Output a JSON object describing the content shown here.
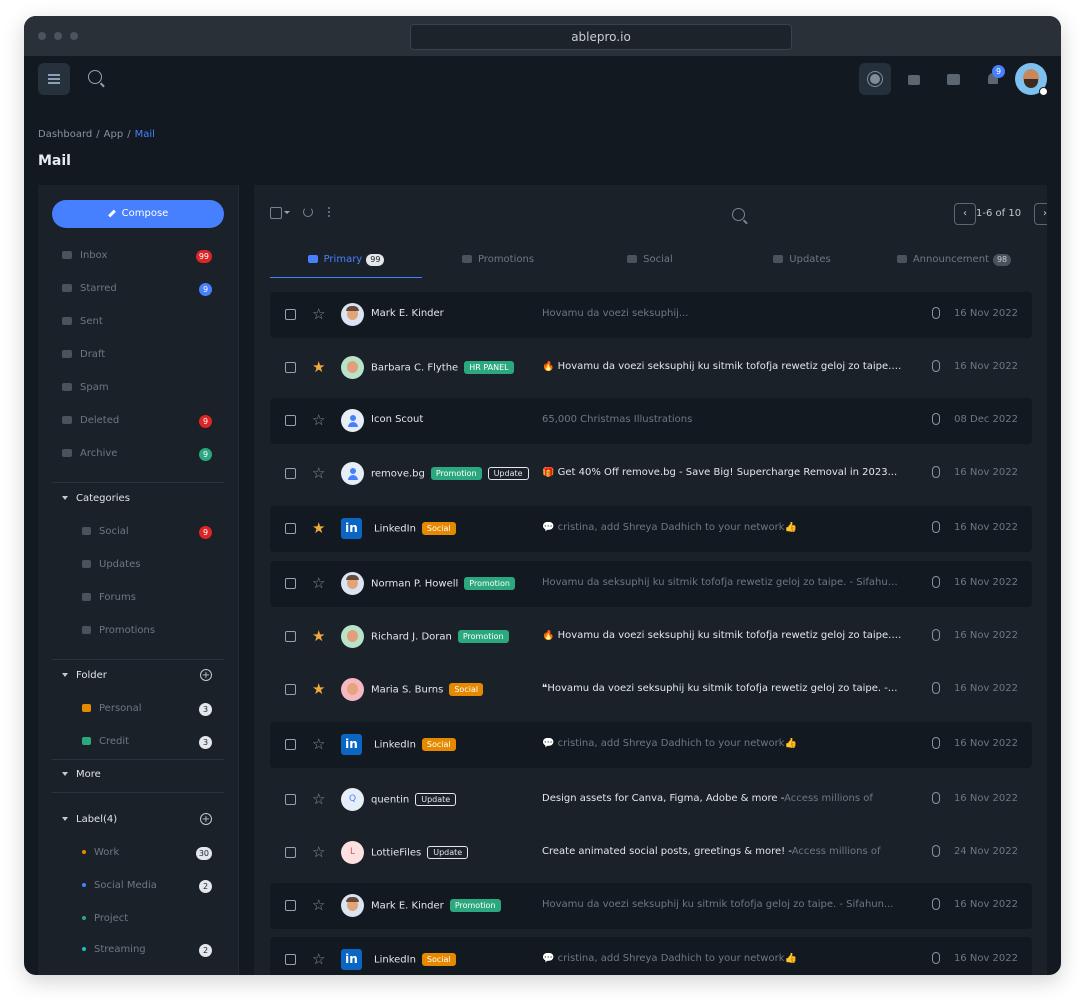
{
  "browser": {
    "url": "ablepro.io"
  },
  "topbar": {
    "notification_count": "9"
  },
  "breadcrumb": {
    "items": [
      "Dashboard",
      "App",
      "Mail"
    ]
  },
  "page": {
    "title": "Mail"
  },
  "sidebar": {
    "compose_label": "Compose",
    "mailboxes": [
      {
        "label": "Inbox",
        "count": "99",
        "badge_color": "#dc2626",
        "icon": "inbox-icon"
      },
      {
        "label": "Starred",
        "count": "9",
        "badge_color": "#4680ff",
        "icon": "star-icon"
      },
      {
        "label": "Sent",
        "count": "",
        "icon": "send-icon"
      },
      {
        "label": "Draft",
        "count": "",
        "icon": "draft-icon"
      },
      {
        "label": "Spam",
        "count": "",
        "icon": "spam-icon"
      },
      {
        "label": "Deleted",
        "count": "9",
        "badge_color": "#dc2626",
        "icon": "trash-icon"
      },
      {
        "label": "Archive",
        "count": "9",
        "badge_color": "#2ca87f",
        "icon": "archive-icon"
      }
    ],
    "categories": {
      "title": "Categories",
      "items": [
        {
          "label": "Social",
          "count": "9",
          "icon": "user-icon"
        },
        {
          "label": "Updates",
          "count": "",
          "icon": "info-icon"
        },
        {
          "label": "Forums",
          "count": "",
          "icon": "forum-icon"
        },
        {
          "label": "Promotions",
          "count": "",
          "icon": "tag-icon"
        }
      ]
    },
    "folder": {
      "title": "Folder",
      "items": [
        {
          "label": "Personal",
          "count": "3",
          "color": "#e58a00"
        },
        {
          "label": "Credit",
          "count": "3",
          "color": "#2ca87f"
        }
      ]
    },
    "more": {
      "title": "More"
    },
    "labels": {
      "title": "Label(4)",
      "items": [
        {
          "label": "Work",
          "count": "30",
          "color": "#e58a00"
        },
        {
          "label": "Social Media",
          "count": "2",
          "color": "#4680ff"
        },
        {
          "label": "Project",
          "count": "",
          "color": "#2ca87f"
        },
        {
          "label": "Streaming",
          "count": "2",
          "color": "#13c2c2"
        }
      ]
    }
  },
  "toolbar": {
    "pager_text": "1-6 of 10",
    "prev_label": "‹",
    "next_label": "›"
  },
  "tabs": [
    {
      "label": "Primary",
      "count": "99",
      "active": true
    },
    {
      "label": "Promotions",
      "count": ""
    },
    {
      "label": "Social",
      "count": ""
    },
    {
      "label": "Updates",
      "count": ""
    },
    {
      "label": "Announcement",
      "count": "98"
    }
  ],
  "emails": [
    {
      "name": "Mark E. Kinder",
      "tags": [],
      "subject": "Hovamu da voezi seksuphij...",
      "subject_bold": false,
      "date": "16 Nov 2022",
      "starred": false
    },
    {
      "name": "Barbara C. Flythe",
      "tags": [
        {
          "text": "HR PANEL",
          "style": "green"
        }
      ],
      "subject": "🔥 Hovamu da voezi seksuphij ku sitmik tofofja rewetiz geloj zo taipe. -...",
      "subject_bold": true,
      "date": "16 Nov 2022",
      "starred": true
    },
    {
      "name": "Icon Scout",
      "tags": [],
      "subject": "65,000 Christmas Illustrations",
      "subject_bold": false,
      "date": "08 Dec 2022",
      "starred": false
    },
    {
      "name": "remove.bg",
      "tags": [
        {
          "text": "Promotion",
          "style": "green"
        },
        {
          "text": "Update",
          "style": "outline"
        }
      ],
      "subject": "🎁 Get 40% Off remove.bg - Save Big! Supercharge Removal in 2023...",
      "subject_bold": true,
      "date": "16 Nov 2022",
      "starred": false
    },
    {
      "name": "LinkedIn",
      "tags": [
        {
          "text": "Social",
          "style": "orange"
        }
      ],
      "subject": "💬 cristina, add Shreya Dadhich to your network👍",
      "subject_bold": false,
      "date": "16 Nov 2022",
      "starred": true
    },
    {
      "name": "Norman P. Howell",
      "tags": [
        {
          "text": "Promotion",
          "style": "green"
        }
      ],
      "subject": "Hovamu da  seksuphij ku sitmik tofofja rewetiz geloj zo taipe. - Sifahun...",
      "subject_bold": false,
      "date": "16 Nov 2022",
      "starred": false
    },
    {
      "name": "Richard J. Doran",
      "tags": [
        {
          "text": "Promotion",
          "style": "green"
        }
      ],
      "subject": "🔥 Hovamu da voezi seksuphij ku sitmik tofofja rewetiz geloj zo taipe. -...",
      "subject_bold": true,
      "date": "16 Nov 2022",
      "starred": true
    },
    {
      "name": "Maria S. Burns",
      "tags": [
        {
          "text": "Social",
          "style": "orange"
        }
      ],
      "subject": "❝Hovamu da voezi seksuphij ku sitmik tofofja rewetiz geloj zo taipe. -...",
      "subject_bold": true,
      "date": "16 Nov 2022",
      "starred": true
    },
    {
      "name": "LinkedIn",
      "tags": [
        {
          "text": "Social",
          "style": "orange"
        }
      ],
      "subject": "💬 cristina, add Shreya Dadhich to your network👍",
      "subject_bold": false,
      "date": "16 Nov 2022",
      "starred": false
    },
    {
      "name": "quentin",
      "tags": [
        {
          "text": "Update",
          "style": "outline"
        }
      ],
      "subject": "Design assets for Canva, Figma, Adobe & more -",
      "subject_rest": "Access millions of",
      "subject_bold": true,
      "date": "16 Nov 2022",
      "starred": false
    },
    {
      "name": "LottieFiles",
      "tags": [
        {
          "text": "Update",
          "style": "outline"
        }
      ],
      "subject": "Create animated social posts, greetings & more! -",
      "subject_rest": "Access millions of",
      "subject_bold": true,
      "date": "24 Nov 2022",
      "starred": false
    },
    {
      "name": "Mark E. Kinder",
      "tags": [
        {
          "text": "Promotion",
          "style": "green"
        }
      ],
      "subject": "Hovamu da voezi seksuphij ku sitmik tofofja  geloj zo taipe. - Sifahun...",
      "subject_bold": false,
      "date": "16 Nov 2022",
      "starred": false
    },
    {
      "name": "LinkedIn",
      "tags": [
        {
          "text": "Social",
          "style": "orange"
        }
      ],
      "subject": "💬 cristina, add Shreya Dadhich to your network👍",
      "subject_bold": false,
      "date": "16 Nov 2022",
      "starred": false
    }
  ],
  "avatars": {
    "Q": "Q",
    "L": "L",
    "in": "in"
  }
}
